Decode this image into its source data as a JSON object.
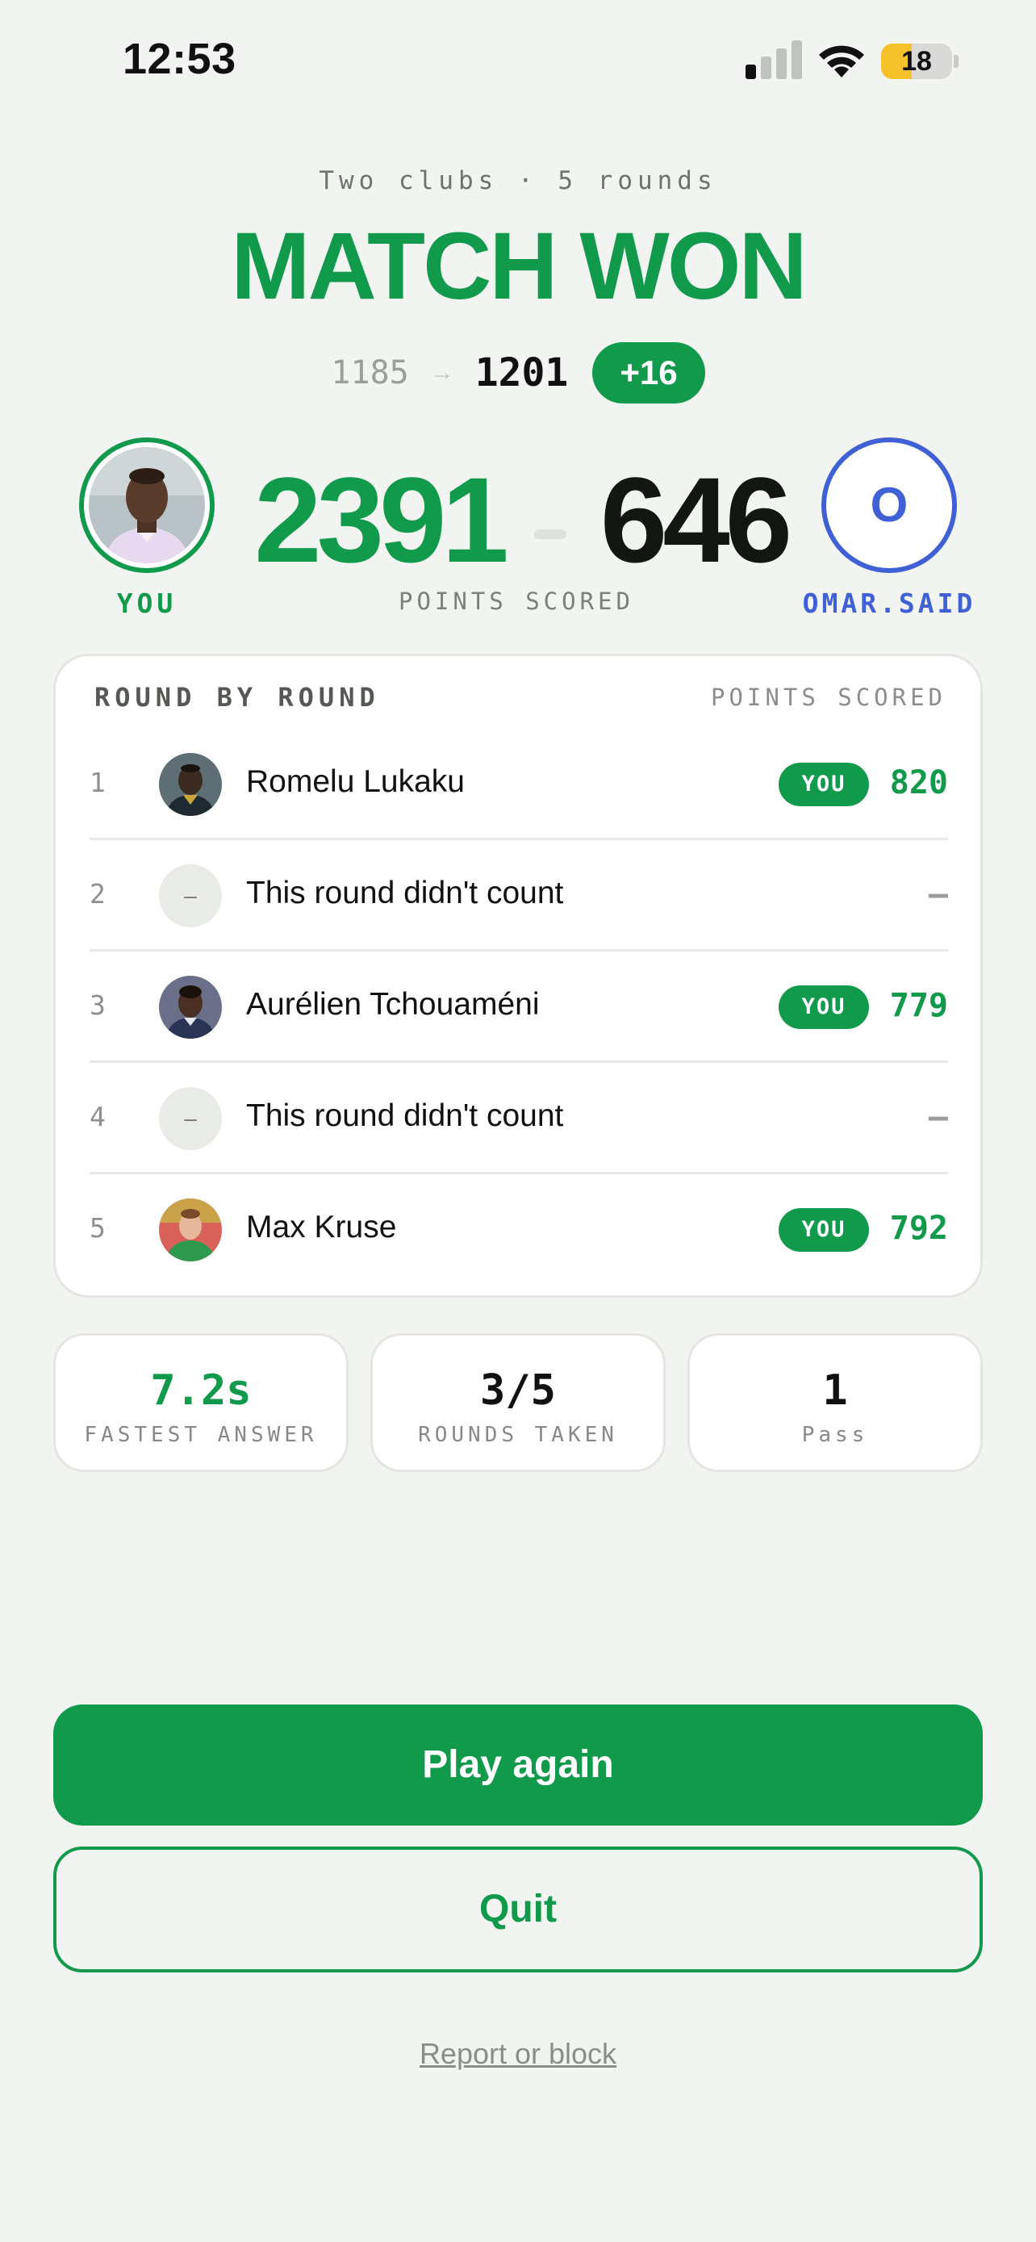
{
  "status_bar": {
    "time": "12:53",
    "battery_level": 18,
    "battery_text": "18"
  },
  "header": {
    "subtitle": "Two clubs · 5 rounds",
    "result": "MATCH WON",
    "rating_old": "1185",
    "rating_arrow": "→",
    "rating_new": "1201",
    "rating_delta": "+16"
  },
  "scoreboard": {
    "you_label": "YOU",
    "you_score": "2391",
    "opponent_score": "646",
    "caption": "POINTS SCORED",
    "opponent_initial": "O",
    "opponent_name": "OMAR.SAID"
  },
  "rounds": {
    "title": "ROUND BY ROUND",
    "column_label": "POINTS SCORED",
    "items": [
      {
        "number": "1",
        "name": "Romelu Lukaku",
        "badge": "YOU",
        "score": "820"
      },
      {
        "number": "2",
        "name": "This round didn't count",
        "placeholder": "–",
        "score": "–"
      },
      {
        "number": "3",
        "name": "Aurélien Tchouaméni",
        "badge": "YOU",
        "score": "779"
      },
      {
        "number": "4",
        "name": "This round didn't count",
        "placeholder": "–",
        "score": "–"
      },
      {
        "number": "5",
        "name": "Max Kruse",
        "badge": "YOU",
        "score": "792"
      }
    ]
  },
  "stats": [
    {
      "value": "7.2s",
      "label": "FASTEST ANSWER"
    },
    {
      "value": "3/5",
      "label": "ROUNDS TAKEN"
    },
    {
      "value": "1",
      "label": "Pass"
    }
  ],
  "actions": {
    "play_again": "Play again",
    "quit": "Quit",
    "report": "Report or block"
  },
  "colors": {
    "accent": "#119a4c",
    "opponent": "#4061d6",
    "background": "#f2f4f1"
  }
}
